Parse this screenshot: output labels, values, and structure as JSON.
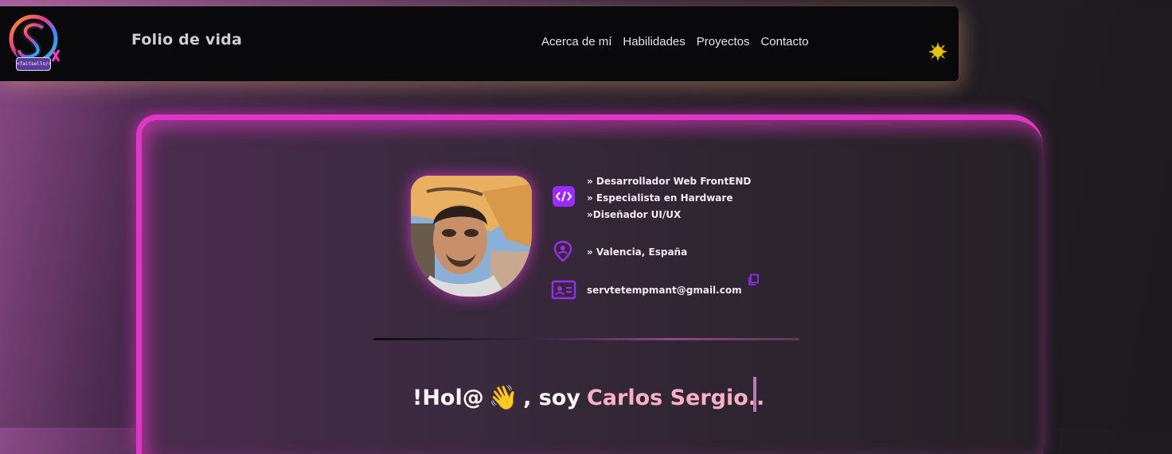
{
  "navbar": {
    "logo_text": "<faitsello/>",
    "brand": "Folio de vida",
    "links": [
      "Acerca de mí",
      "Habilidades",
      "Proyectos",
      "Contacto"
    ],
    "theme_icon": "sun-icon"
  },
  "profile": {
    "roles": [
      "» Desarrollador Web FrontEND",
      "» Especialista en Hardware",
      "»Diseñador UI/UX"
    ],
    "location": "» Valencia, España",
    "email": "servtetempmant@gmail.com",
    "icons": {
      "roles": "code-icon",
      "location": "location-pin-icon",
      "email": "contact-card-icon",
      "copy": "copy-icon"
    }
  },
  "hero": {
    "greeting_prefix": "!Hol@",
    "wave": "👋",
    "greeting_mid": ", soy",
    "name": "Carlos Sergio.."
  },
  "colors": {
    "accent": "#e036c8",
    "icon_purple": "#9a2cff",
    "name_pink": "#ffb0c8"
  }
}
